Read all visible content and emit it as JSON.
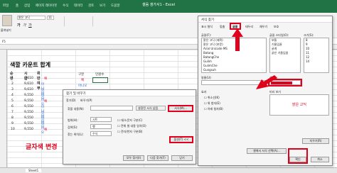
{
  "window": {
    "title": "셀음 갱가서1 - Excel"
  },
  "ribbon": {
    "tabs": [
      "파일",
      "홈",
      "삽입",
      "페이지 레이아웃",
      "수식",
      "데이터",
      "검토",
      "보기",
      "도움말"
    ],
    "paste_label": "붙여넣기",
    "font_name": "맑은 고딕",
    "font_size": "11",
    "cell_ref": "F5"
  },
  "sheet": {
    "title": "색깔 카운트 합계",
    "headers": [
      "순번",
      "시급",
      "위반여부"
    ],
    "rows": [
      {
        "no": "1",
        "pay": "9,610",
        "flag": "예"
      },
      {
        "no": "2",
        "pay": "9,610",
        "flag": "아니오"
      },
      {
        "no": "3",
        "pay": "9,610",
        "flag": "아니오"
      },
      {
        "no": "4",
        "pay": "9,550",
        "flag": "아니오"
      },
      {
        "no": "5",
        "pay": "9,550",
        "flag": "예"
      },
      {
        "no": "6",
        "pay": "9,550",
        "flag": "아니오"
      },
      {
        "no": "7",
        "pay": "9,550",
        "flag": "아니오"
      },
      {
        "no": "8",
        "pay": "9,550",
        "flag": "아니오"
      },
      {
        "no": "9",
        "pay": "9,550",
        "flag": "아니오"
      },
      {
        "no": "10",
        "pay": "9,550",
        "flag": "예"
      }
    ],
    "side_headers": [
      "구분",
      "인원수"
    ],
    "side_rows": [
      "예",
      "아니오"
    ],
    "tab": "Sheet1"
  },
  "find_dialog": {
    "title": "찾기 및 바꾸기",
    "tabs": [
      "찾기(D)",
      "바꾸기(P)"
    ],
    "find_label": "찾을 내용(N):",
    "preview_label": "설정된 서식 없음",
    "format_button": "서식(M)...",
    "within_label": "범위(H):",
    "within_value": "시트",
    "search_label": "검색(S):",
    "search_value": "행",
    "lookin_label": "찾는 위치(L):",
    "lookin_value": "수식",
    "options": [
      "대/소문자 구분(C)",
      "전체 셀 내용 일치(O)",
      "전자/반자 구분(B)"
    ],
    "options_button": "옵션(T) <<",
    "buttons": [
      "모두 찾기(I)",
      "다음 찾기(F)",
      "닫기"
    ]
  },
  "format_dialog": {
    "title": "서식 찾기",
    "tabs": [
      "표시 형식",
      "맞춤",
      "글꼴",
      "테두리",
      "채우기",
      "보호"
    ],
    "font_label": "글꼴(F):",
    "style_label": "글꼴 스타일(O):",
    "size_label": "크기(S):",
    "fonts": [
      "맑은 고딕 (제목)",
      "맑은 고딕 (본문)",
      "Arial Unicode MS",
      "Batang",
      "BatangChe",
      "Gulim",
      "GulimChe",
      "Gungsuh"
    ],
    "styles": [
      "보통",
      "기울임꼴",
      "굵게",
      "굵은 기울임꼴"
    ],
    "sizes": [
      "8",
      "9",
      "10",
      "11",
      "12",
      "14"
    ],
    "underline_label": "밑줄(U):",
    "color_label": "색(C):",
    "effects_label": "효과",
    "effects": [
      "취소선(K)",
      "위 첨자(E)",
      "아래 첨자(B)"
    ],
    "preview_label": "미리 보기",
    "preview_text": "맑은 고딕",
    "clear_button": "지우기(R)",
    "choose_button": "셀에서 서식 선택(A)...",
    "ok_button": "확인",
    "cancel_button": "취소",
    "accent": "#e0001b"
  },
  "annotation": {
    "text": "글자색 변경"
  }
}
